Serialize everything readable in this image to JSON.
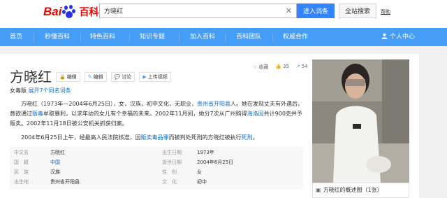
{
  "header": {
    "logo_text_left": "Bai",
    "logo_text_right": "百科",
    "search_value": "方晓红",
    "enter_label": "进入词条",
    "search_label": "全站搜索",
    "help_label": "帮助"
  },
  "nav": {
    "items": [
      "首页",
      "秒懂百科",
      "特色百科",
      "知识专题",
      "加入百科",
      "百科团队",
      "权威合作"
    ],
    "user_label": "个人中心"
  },
  "entry": {
    "title": "方晓红",
    "tools": [
      "编辑",
      "编辑",
      "讨论",
      "上传视频"
    ],
    "poly_label": "女毒贩",
    "poly_link": "展开7个同名词条",
    "stats": {
      "collect_label": "收藏",
      "likes": "35",
      "shares": "54"
    },
    "para1_a": "方晓红（1973年—2004年6月25日），女，汉族，初中文化，无职业，",
    "para1_link": "贵州省开阳县",
    "para1_b": "人。她在发现丈夫有外遇后，竟欲通过",
    "para1_link2": "贩毒",
    "para1_c": "牟取暴利，以求年幼的女儿有个幸福的未来。2002年11月间，她分7次从广州购得",
    "para1_link3": "海洛因",
    "para1_d": "共计900克并予贩卖。2002年11月18日被公安机关抓获归案。",
    "para2_a": "2004年6月25日上午，经最高人民法院核准，因",
    "para2_link": "贩卖毒品罪",
    "para2_b": "而被判处死刑的方晓红被执行",
    "para2_link2": "死刑",
    "para2_c": "。",
    "basic_info": [
      {
        "left_name": "中文名",
        "left_value": "方晓红",
        "right_name": "出生日期",
        "right_value": "1973年"
      },
      {
        "left_name": "国　籍",
        "left_value": "中国",
        "right_name": "逝世日期",
        "right_value": "2004年6月25日"
      },
      {
        "left_name": "民　族",
        "left_value": "汉族",
        "right_name": "性　别",
        "right_value": "女"
      },
      {
        "left_name": "出生地",
        "left_value": "贵州省开阳县",
        "right_name": "文　化",
        "right_value": "初中"
      }
    ],
    "photo_caption": "方晓红的概述图（1张）"
  }
}
